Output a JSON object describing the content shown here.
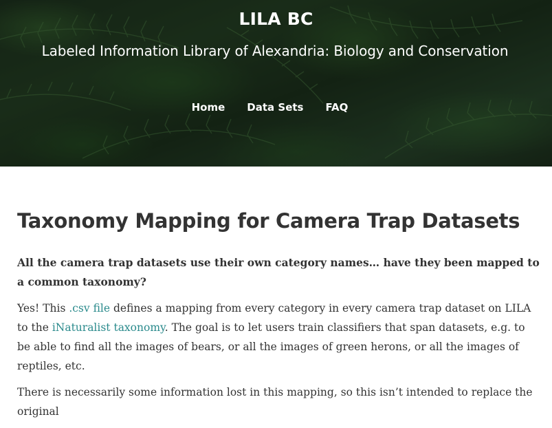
{
  "site": {
    "title": "LILA BC",
    "subtitle": "Labeled Information Library of Alexandria: Biology and Conservation"
  },
  "nav": {
    "items": [
      {
        "label": "Home"
      },
      {
        "label": "Data Sets"
      },
      {
        "label": "FAQ"
      }
    ]
  },
  "page": {
    "heading": "Taxonomy Mapping for Camera Trap Datasets",
    "question": "All the camera trap datasets use their own category names… have they been mapped to a common taxonomy?",
    "answer": {
      "prefix": "Yes! This ",
      "csv_link": ".csv file",
      "middle": " defines a mapping from every category in every camera trap dataset on LILA to the ",
      "inat_link": "iNaturalist taxonomy",
      "suffix": ". The goal is to let users train classifiers that span datasets, e.g. to be able to find all the images of bears, or all the images of green herons, or all the images of reptiles, etc."
    },
    "note": "There is necessarily some information lost in this mapping, so this isn’t intended to replace the original"
  },
  "colors": {
    "link": "#2a8a8c",
    "text": "#333333",
    "hero_overlay": "#1b2b1c"
  },
  "hero": {
    "background": "fern-leaves-image"
  }
}
